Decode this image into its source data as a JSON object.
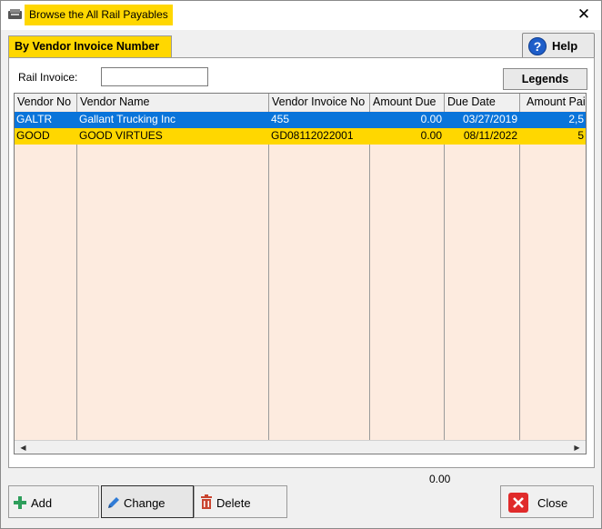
{
  "window": {
    "title": "Browse the All Rail Payables"
  },
  "tab": {
    "label": "By Vendor Invoice Number"
  },
  "help": {
    "label": "Help"
  },
  "filter": {
    "label": "Rail Invoice:",
    "value": ""
  },
  "legends": {
    "label": "Legends"
  },
  "grid": {
    "columns": [
      "Vendor No",
      "Vendor Name",
      "Vendor Invoice No",
      "Amount Due",
      "Due Date",
      "Amount Paid"
    ],
    "rows": [
      [
        "GALTR",
        "Gallant Trucking Inc",
        "455",
        "0.00",
        "03/27/2019",
        "2,5"
      ],
      [
        "GOOD",
        "GOOD VIRTUES",
        "GD08112022001",
        "0.00",
        "08/11/2022",
        "5"
      ]
    ]
  },
  "footer": {
    "total": "0.00"
  },
  "buttons": {
    "add": "Add",
    "change": "Change",
    "delete": "Delete",
    "close": "Close"
  },
  "colors": {
    "accent_yellow": "#ffd700",
    "selection_blue": "#0a74da",
    "grid_background": "#fdebdf"
  }
}
